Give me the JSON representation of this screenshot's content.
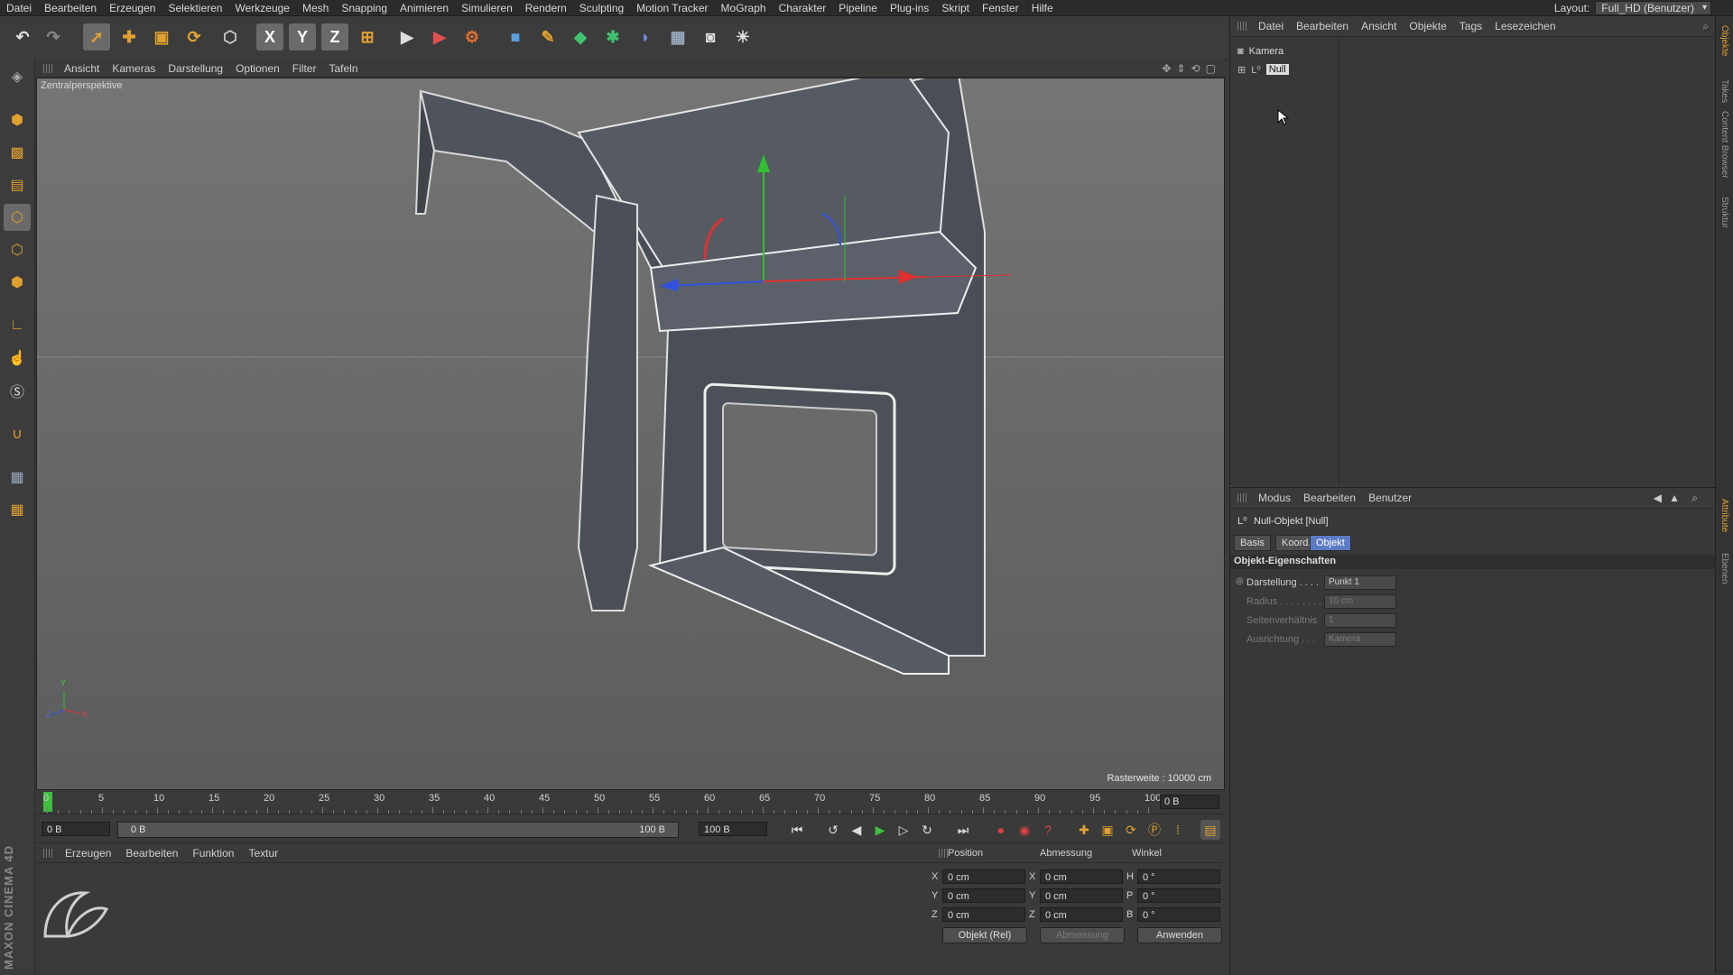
{
  "menubar": {
    "items": [
      "Datei",
      "Bearbeiten",
      "Erzeugen",
      "Selektieren",
      "Werkzeuge",
      "Mesh",
      "Snapping",
      "Animieren",
      "Simulieren",
      "Rendern",
      "Sculpting",
      "Motion Tracker",
      "MoGraph",
      "Charakter",
      "Pipeline",
      "Plug-ins",
      "Skript",
      "Fenster",
      "Hilfe"
    ],
    "layout_label": "Layout:",
    "layout_value": "Full_HD (Benutzer)"
  },
  "toolbar": {
    "axis_x": "X",
    "axis_y": "Y",
    "axis_z": "Z",
    "icons": [
      "undo-icon",
      "redo-icon",
      "select-icon",
      "move-icon",
      "scale-icon",
      "rotate-icon",
      "object-mode-icon",
      "axis-x-icon",
      "axis-y-icon",
      "axis-z-icon",
      "coord-system-icon",
      "render-view-icon",
      "render-picture-icon",
      "render-settings-icon",
      "cube-icon",
      "pen-icon",
      "subdivision-icon",
      "cloner-icon",
      "deformer-icon",
      "floor-icon",
      "camera-icon",
      "light-icon"
    ]
  },
  "viewport": {
    "menu": [
      "Ansicht",
      "Kameras",
      "Darstellung",
      "Optionen",
      "Filter",
      "Tafeln"
    ],
    "label": "Zentralperspektive",
    "raster": "Rasterweite : 10000 cm",
    "axis_y": "Y",
    "axis_z": "Z",
    "axis_x": "X"
  },
  "timeline": {
    "ticks": [
      "0",
      "5",
      "10",
      "15",
      "20",
      "25",
      "30",
      "35",
      "40",
      "45",
      "50",
      "55",
      "60",
      "65",
      "70",
      "75",
      "80",
      "85",
      "90",
      "95",
      "100"
    ],
    "current_frame": "0 B"
  },
  "transport": {
    "start_field": "0 B",
    "range_start": "0 B",
    "range_end": "100 B",
    "end_field": "100 B"
  },
  "materials": {
    "menu": [
      "Erzeugen",
      "Bearbeiten",
      "Funktion",
      "Textur"
    ]
  },
  "coordinates": {
    "headers": [
      "Position",
      "Abmessung",
      "Winkel"
    ],
    "rows": [
      {
        "a": "X",
        "pos": "0 cm",
        "b": "X",
        "size": "0 cm",
        "c": "H",
        "rot": "0 °"
      },
      {
        "a": "Y",
        "pos": "0 cm",
        "b": "Y",
        "size": "0 cm",
        "c": "P",
        "rot": "0 °"
      },
      {
        "a": "Z",
        "pos": "0 cm",
        "b": "Z",
        "size": "0 cm",
        "c": "B",
        "rot": "0 °"
      }
    ],
    "mode": "Objekt (Rel)",
    "size_mode": "Abmessung",
    "apply": "Anwenden"
  },
  "objects": {
    "menu": [
      "Datei",
      "Bearbeiten",
      "Ansicht",
      "Objekte",
      "Tags",
      "Lesezeichen"
    ],
    "items": [
      {
        "name": "Kamera"
      },
      {
        "name": "Null"
      }
    ]
  },
  "attributes": {
    "menu": [
      "Modus",
      "Bearbeiten",
      "Benutzer"
    ],
    "object_title": "Null-Objekt [Null]",
    "tabs": [
      "Basis",
      "Koord.",
      "Objekt"
    ],
    "active_tab": "Objekt",
    "section": "Objekt-Eigenschaften",
    "props": [
      {
        "label": "Darstellung . . . .",
        "value": "Punkt 1"
      },
      {
        "label": "Radius . . . . . . . .",
        "value": "10 cm"
      },
      {
        "label": "Seitenverhältnis",
        "value": "1"
      },
      {
        "label": "Ausrichtung . . .",
        "value": "Kamera"
      }
    ]
  },
  "right_strip": [
    "Objekte",
    "Takes",
    "Content Browser",
    "Struktur",
    "Attribute",
    "Ebenen"
  ],
  "brand": "MAXON CINEMA 4D"
}
